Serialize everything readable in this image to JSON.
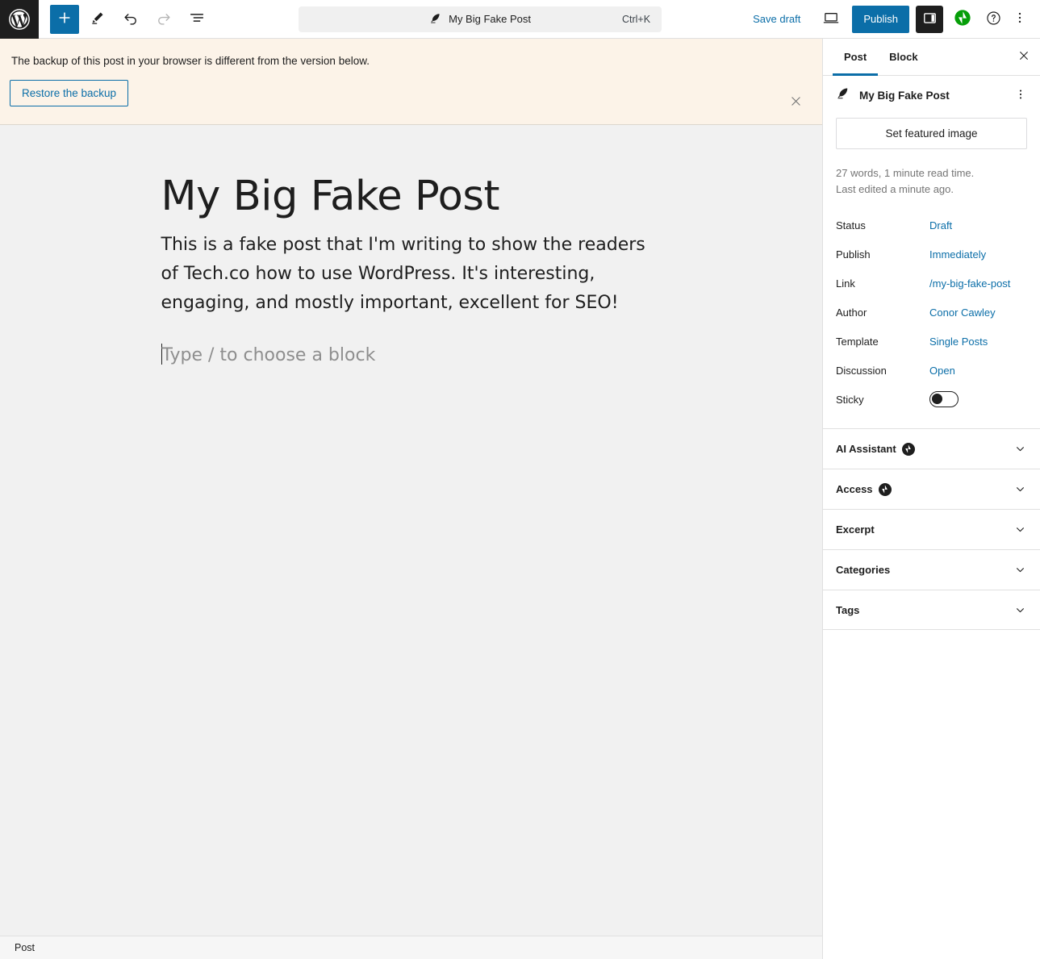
{
  "header": {
    "logo_label": "WordPress",
    "tools": [
      {
        "name": "add-block",
        "label": "Add block"
      },
      {
        "name": "edit-tool",
        "label": "Tools"
      },
      {
        "name": "undo",
        "label": "Undo"
      },
      {
        "name": "redo",
        "label": "Redo"
      },
      {
        "name": "document-overview",
        "label": "Document Overview"
      }
    ],
    "command_bar": {
      "icon": "feather-icon",
      "title": "My Big Fake Post",
      "shortcut": "Ctrl+K"
    },
    "save_draft": "Save draft",
    "preview_icon": "desktop-preview-icon",
    "publish": "Publish",
    "settings_toggle_icon": "sidebar-panel-icon",
    "jetpack_icon": "jetpack-icon",
    "help_icon": "help-circle-icon",
    "more_icon": "kebab-menu-icon",
    "accent_color": "#0b6ea8"
  },
  "notice": {
    "text": "The backup of this post in your browser is different from the version below.",
    "action_label": "Restore the backup",
    "dismiss_icon": "close-icon",
    "background_color": "#fcf3e8"
  },
  "editor": {
    "title": "My Big Fake Post",
    "paragraph": "This is a fake post that I'm writing to show the readers of Tech.co how to use WordPress. It's interesting, engaging, and mostly important, excellent for SEO!",
    "placeholder": "Type / to choose a block"
  },
  "sidebar": {
    "tabs": [
      {
        "label": "Post",
        "active": true
      },
      {
        "label": "Block",
        "active": false
      }
    ],
    "close_icon": "close-icon",
    "post": {
      "icon": "feather-icon",
      "title": "My Big Fake Post",
      "more_icon": "kebab-menu-icon",
      "featured_image_label": "Set featured image"
    },
    "meta": {
      "words": "27 words, 1 minute read time.",
      "last_edited": "Last edited a minute ago."
    },
    "fields": [
      {
        "label": "Status",
        "value": "Draft",
        "type": "link"
      },
      {
        "label": "Publish",
        "value": "Immediately",
        "type": "link"
      },
      {
        "label": "Link",
        "value": "/my-big-fake-post",
        "type": "link"
      },
      {
        "label": "Author",
        "value": "Conor Cawley",
        "type": "link"
      },
      {
        "label": "Template",
        "value": "Single Posts",
        "type": "link"
      },
      {
        "label": "Discussion",
        "value": "Open",
        "type": "link"
      },
      {
        "label": "Sticky",
        "value": "off",
        "type": "toggle"
      }
    ],
    "panels": [
      {
        "label": "AI Assistant",
        "badge": "jetpack-icon",
        "expanded": false
      },
      {
        "label": "Access",
        "badge": "jetpack-icon",
        "expanded": false
      },
      {
        "label": "Excerpt",
        "badge": null,
        "expanded": false
      },
      {
        "label": "Categories",
        "badge": null,
        "expanded": false
      },
      {
        "label": "Tags",
        "badge": null,
        "expanded": false
      }
    ]
  },
  "footer": {
    "breadcrumb": "Post"
  }
}
